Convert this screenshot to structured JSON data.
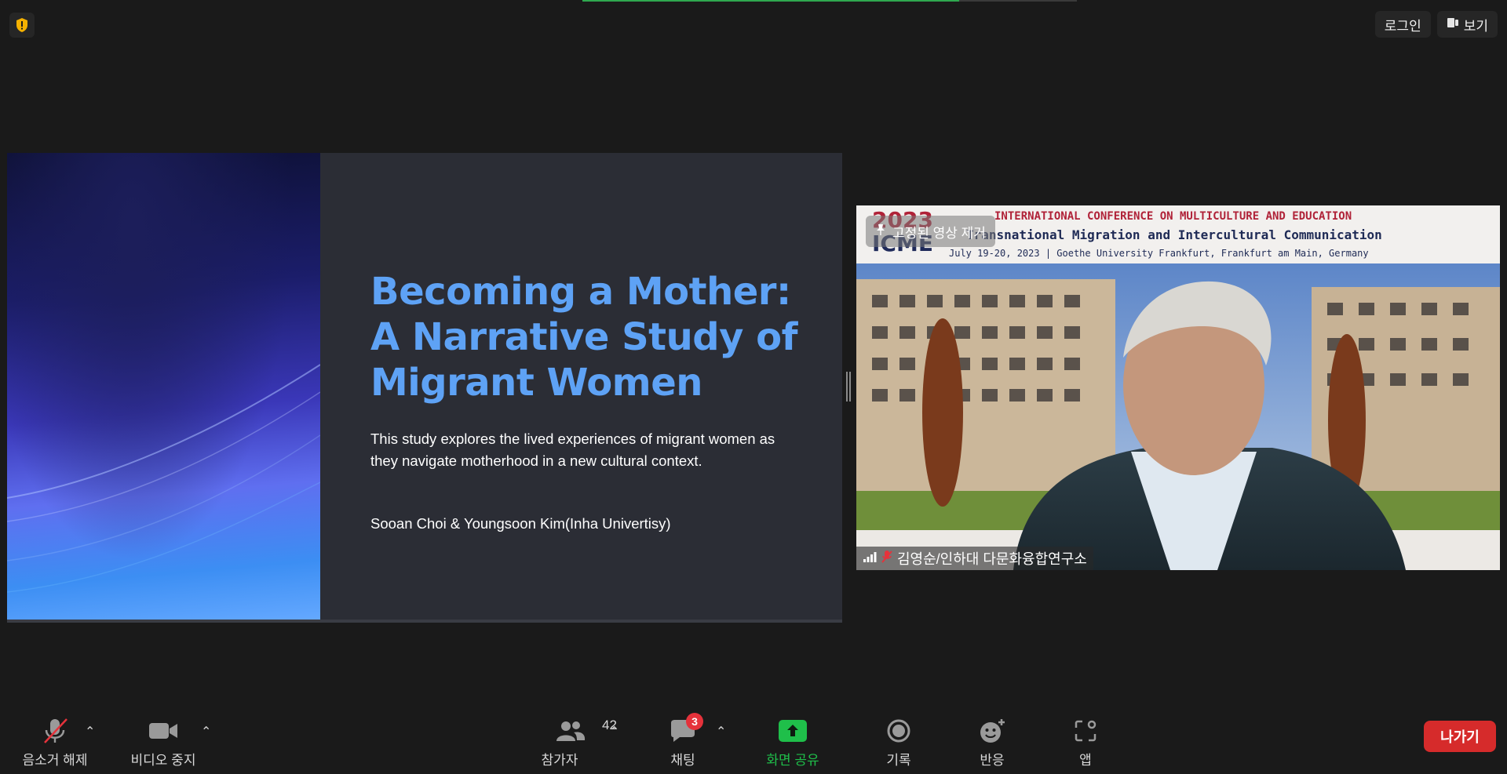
{
  "top_bar": {
    "login_label": "로그인",
    "view_label": "보기"
  },
  "slide": {
    "title_line1": "Becoming a Mother:",
    "title_line2": "A Narrative Study of",
    "title_line3": "Migrant Women",
    "body": "This study explores the lived experiences of migrant women as they navigate motherhood in a new cultural context.",
    "authors": "Sooan Choi & Youngsoon Kim(Inha Univertisy)"
  },
  "video": {
    "pin_label": "고정된 영상 제거",
    "participant_name": "김영순/인하대 다문화융합연구소",
    "banner_year": "2023",
    "banner_acronym": "ICME",
    "banner_line1": "INTERNATIONAL CONFERENCE ON MULTICULTURE AND EDUCATION",
    "banner_line2": "Transnational Migration and Intercultural Communication",
    "banner_line3": "July 19-20, 2023 | Goethe University Frankfurt, Frankfurt am Main, Germany"
  },
  "toolbar": {
    "unmute_label": "음소거 해제",
    "stop_video_label": "비디오 중지",
    "participants_label": "참가자",
    "participants_count": "42",
    "chat_label": "채팅",
    "chat_badge": "3",
    "share_label": "화면 공유",
    "record_label": "기록",
    "reactions_label": "반응",
    "apps_label": "앱",
    "leave_label": "나가기"
  },
  "colors": {
    "share_green": "#1fbf4a",
    "leave_red": "#d62b2b",
    "title_blue": "#5ea2f5"
  }
}
